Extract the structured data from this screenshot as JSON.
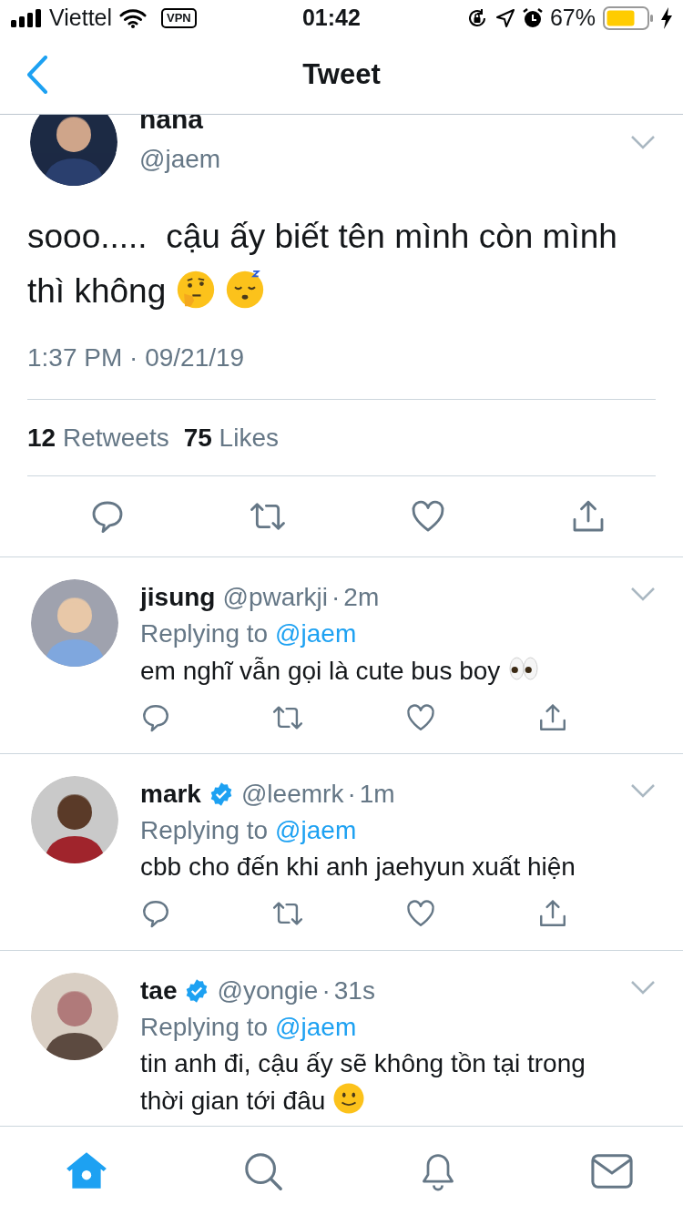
{
  "status_bar": {
    "carrier": "Viettel",
    "vpn": "VPN",
    "time": "01:42",
    "battery": "67%"
  },
  "nav": {
    "title": "Tweet"
  },
  "tweet": {
    "name": "nana",
    "handle": "@jaem",
    "text": "sooo.....  cậu ấy biết tên mình còn mình thì không",
    "emoji": [
      {
        "kind": "thinking"
      },
      {
        "kind": "sleeping"
      }
    ],
    "timestamp": "1:37 PM · 09/21/19",
    "retweets": "12",
    "retweets_label": "Retweets",
    "likes": "75",
    "likes_label": "Likes"
  },
  "replies": [
    {
      "name": "jisung",
      "verified": false,
      "handle": "@pwarkji",
      "separator": "·",
      "time": "2m",
      "replying_prefix": "Replying to",
      "replying_to": "@jaem",
      "text": "em nghĩ vẫn gọi là cute bus boy",
      "emoji": [
        {
          "kind": "eyes"
        }
      ]
    },
    {
      "name": "mark",
      "verified": true,
      "handle": "@leemrk",
      "separator": "·",
      "time": "1m",
      "replying_prefix": "Replying to",
      "replying_to": "@jaem",
      "text": "cbb cho đến khi anh jaehyun xuất hiện"
    },
    {
      "name": "tae",
      "verified": true,
      "handle": "@yongie",
      "separator": "·",
      "time": "31s",
      "replying_prefix": "Replying to",
      "replying_to": "@jaem",
      "text": "tin anh đi, cậu ấy sẽ không tồn tại trong thời gian tới đâu",
      "emoji": [
        {
          "kind": "smile"
        }
      ]
    }
  ],
  "tab_bar": [
    {
      "kind": "home",
      "selected": true
    },
    {
      "kind": "search",
      "selected": false
    },
    {
      "kind": "notifications",
      "selected": false
    },
    {
      "kind": "messages",
      "selected": false
    }
  ]
}
